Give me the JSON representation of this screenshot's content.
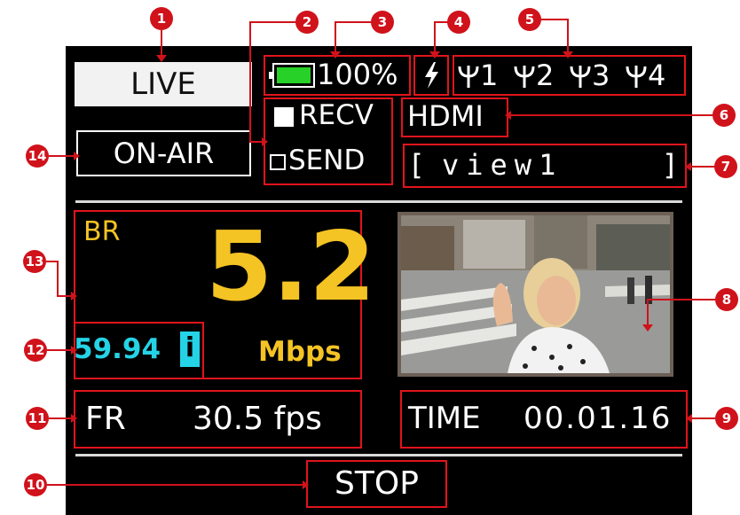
{
  "status": {
    "live_label": "LIVE",
    "onair_label": "ON-AIR",
    "battery_percent": "100%",
    "battery_level": 1.0,
    "power_icon": "lightning-icon",
    "antenna_icon": "antenna-icon",
    "antennas": [
      "1",
      "2",
      "3",
      "4"
    ],
    "recv_label": "RECV",
    "send_label": "SEND",
    "input_label": "HDMI",
    "view_open": "[",
    "view_name": "view1",
    "view_close": "]"
  },
  "stats": {
    "br_label": "BR",
    "br_value": "5.2",
    "br_unit": "Mbps",
    "frame_rate": "59.94",
    "scan_mode": "i",
    "fr_label": "FR",
    "fr_value": "30.5 fps",
    "time_label": "TIME",
    "time_value": "00.01.16"
  },
  "controls": {
    "stop_label": "STOP"
  },
  "callouts": [
    "1",
    "2",
    "3",
    "4",
    "5",
    "6",
    "7",
    "8",
    "9",
    "10",
    "11",
    "12",
    "13",
    "14"
  ],
  "colors": {
    "accent_yellow": "#f4c324",
    "accent_cyan": "#25d3e6",
    "callout_red": "#d0121b",
    "battery_green": "#27d127"
  }
}
